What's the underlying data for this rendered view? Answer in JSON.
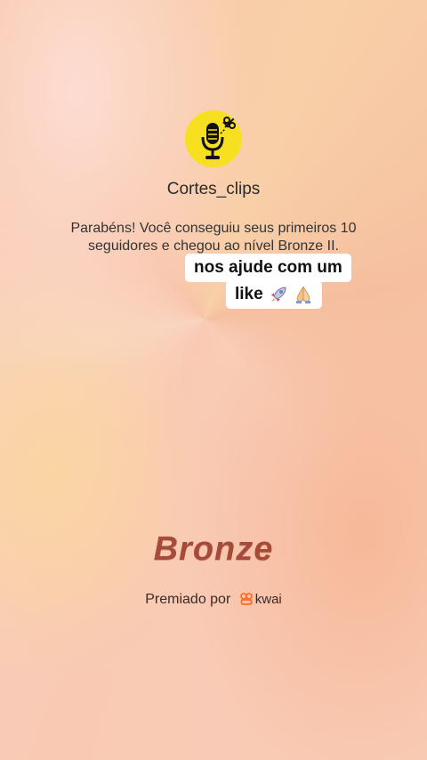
{
  "profile": {
    "username": "Cortes_clips",
    "avatar_icon": "microphone-scissors-icon",
    "avatar_color": "#f7e020"
  },
  "message": "Parabéns! Você conseguiu seus primeiros 10 seguidores e chegou ao nível Bronze II.",
  "sticker": {
    "line1": "nos ajude com um",
    "line2": "like",
    "emoji_icons": [
      "rocket-icon",
      "praying-hands-icon"
    ]
  },
  "level_badge": "Bronze",
  "awarded": {
    "prefix": "Premiado por",
    "brand": "kwai",
    "brand_icon": "kwai-logo-icon",
    "brand_color": "#ff6a2b"
  }
}
